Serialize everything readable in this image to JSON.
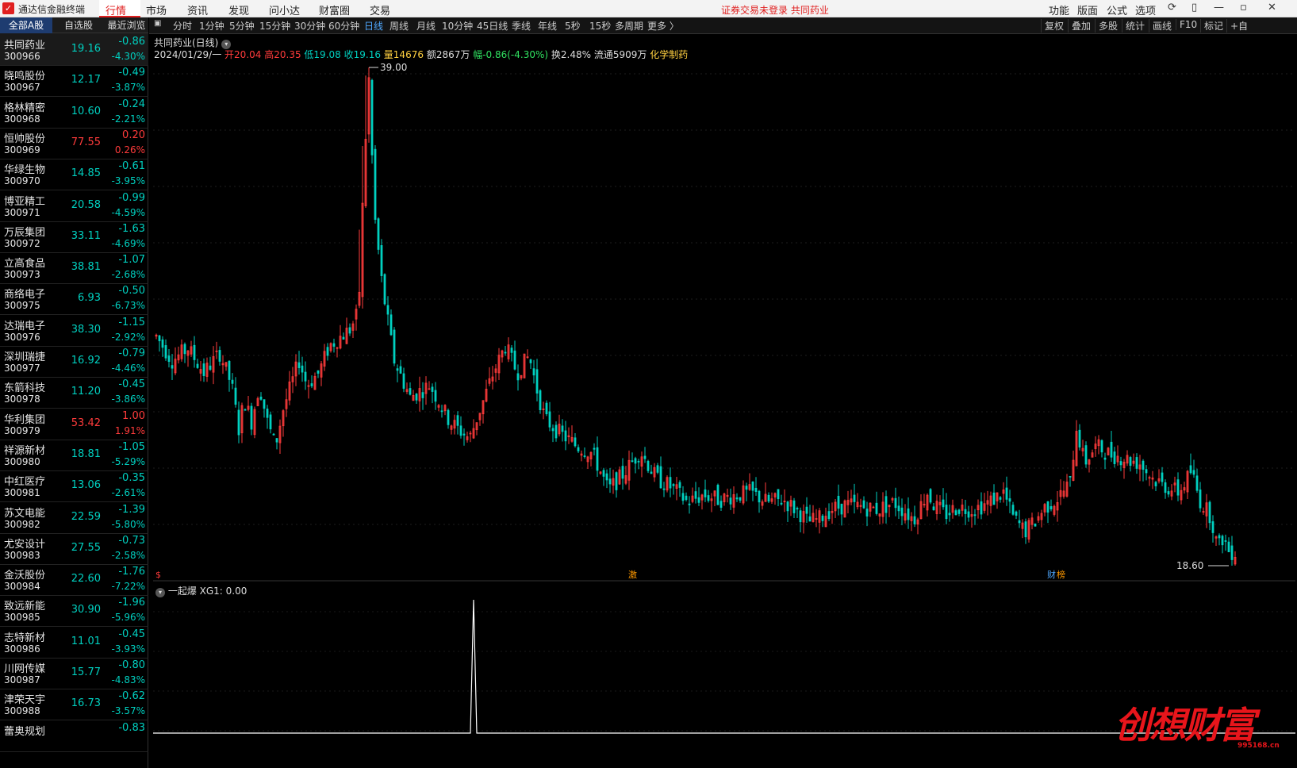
{
  "app": {
    "title": "通达信金融终端",
    "warning": "证券交易未登录 共同药业"
  },
  "main_menu": [
    "行情",
    "市场",
    "资讯",
    "发现",
    "问小达",
    "财富圈",
    "交易"
  ],
  "right_menu": [
    "功能",
    "版面",
    "公式",
    "选项"
  ],
  "left_tabs": [
    "全部A股",
    "自选股",
    "最近浏览"
  ],
  "stocks": [
    {
      "name": "共同药业",
      "code": "300966",
      "price": "19.16",
      "chg": "-0.86",
      "pct": "-4.30%",
      "dir": "dn"
    },
    {
      "name": "晓鸣股份",
      "code": "300967",
      "price": "12.17",
      "chg": "-0.49",
      "pct": "-3.87%",
      "dir": "dn"
    },
    {
      "name": "格林精密",
      "code": "300968",
      "price": "10.60",
      "chg": "-0.24",
      "pct": "-2.21%",
      "dir": "dn"
    },
    {
      "name": "恒帅股份",
      "code": "300969",
      "price": "77.55",
      "chg": "0.20",
      "pct": "0.26%",
      "dir": "up"
    },
    {
      "name": "华绿生物",
      "code": "300970",
      "price": "14.85",
      "chg": "-0.61",
      "pct": "-3.95%",
      "dir": "dn"
    },
    {
      "name": "博亚精工",
      "code": "300971",
      "price": "20.58",
      "chg": "-0.99",
      "pct": "-4.59%",
      "dir": "dn"
    },
    {
      "name": "万辰集团",
      "code": "300972",
      "price": "33.11",
      "chg": "-1.63",
      "pct": "-4.69%",
      "dir": "dn"
    },
    {
      "name": "立高食品",
      "code": "300973",
      "price": "38.81",
      "chg": "-1.07",
      "pct": "-2.68%",
      "dir": "dn"
    },
    {
      "name": "商络电子",
      "code": "300975",
      "price": "6.93",
      "chg": "-0.50",
      "pct": "-6.73%",
      "dir": "dn"
    },
    {
      "name": "达瑞电子",
      "code": "300976",
      "price": "38.30",
      "chg": "-1.15",
      "pct": "-2.92%",
      "dir": "dn"
    },
    {
      "name": "深圳瑞捷",
      "code": "300977",
      "price": "16.92",
      "chg": "-0.79",
      "pct": "-4.46%",
      "dir": "dn"
    },
    {
      "name": "东箭科技",
      "code": "300978",
      "price": "11.20",
      "chg": "-0.45",
      "pct": "-3.86%",
      "dir": "dn"
    },
    {
      "name": "华利集团",
      "code": "300979",
      "price": "53.42",
      "chg": "1.00",
      "pct": "1.91%",
      "dir": "up"
    },
    {
      "name": "祥源新材",
      "code": "300980",
      "price": "18.81",
      "chg": "-1.05",
      "pct": "-5.29%",
      "dir": "dn"
    },
    {
      "name": "中红医疗",
      "code": "300981",
      "price": "13.06",
      "chg": "-0.35",
      "pct": "-2.61%",
      "dir": "dn"
    },
    {
      "name": "苏文电能",
      "code": "300982",
      "price": "22.59",
      "chg": "-1.39",
      "pct": "-5.80%",
      "dir": "dn"
    },
    {
      "name": "尤安设计",
      "code": "300983",
      "price": "27.55",
      "chg": "-0.73",
      "pct": "-2.58%",
      "dir": "dn"
    },
    {
      "name": "金沃股份",
      "code": "300984",
      "price": "22.60",
      "chg": "-1.76",
      "pct": "-7.22%",
      "dir": "dn"
    },
    {
      "name": "致远新能",
      "code": "300985",
      "price": "30.90",
      "chg": "-1.96",
      "pct": "-5.96%",
      "dir": "dn"
    },
    {
      "name": "志特新材",
      "code": "300986",
      "price": "11.01",
      "chg": "-0.45",
      "pct": "-3.93%",
      "dir": "dn"
    },
    {
      "name": "川网传媒",
      "code": "300987",
      "price": "15.77",
      "chg": "-0.80",
      "pct": "-4.83%",
      "dir": "dn"
    },
    {
      "name": "津荣天宇",
      "code": "300988",
      "price": "16.73",
      "chg": "-0.62",
      "pct": "-3.57%",
      "dir": "dn"
    },
    {
      "name": "蕾奥规划",
      "code": "",
      "price": "",
      "chg": "-0.83",
      "pct": "",
      "dir": "dn"
    }
  ],
  "periods": [
    "分时",
    "1分钟",
    "5分钟",
    "15分钟",
    "30分钟",
    "60分钟",
    "日线",
    "周线",
    "月线",
    "10分钟",
    "45日线",
    "季线",
    "年线",
    "5秒",
    "15秒",
    "多周期",
    "更多 〉"
  ],
  "tools": [
    "复权",
    "叠加",
    "多股",
    "统计",
    "画线",
    "F10",
    "标记",
    "+自"
  ],
  "chart_title": "共同药业(日线)",
  "info": {
    "date": "2024/01/29/一",
    "open": "开20.04",
    "high": "高20.35",
    "low": "低19.08",
    "close": "收19.16",
    "vol": "量14676",
    "amount": "额2867万",
    "range": "幅-0.86(-4.30%)",
    "turnover": "换2.48%",
    "float": "流通5909万",
    "industry": "化学制药"
  },
  "high_label": "39.00",
  "low_label": "18.60",
  "event_marks": [
    "激",
    "财",
    "榜"
  ],
  "sub_indicator": "一起爆  XG1: 0.00",
  "watermark": {
    "brand": "创想财富",
    "url": "995168.cn"
  },
  "colors": {
    "up": "#ff3b3b",
    "down": "#00d0c0",
    "accent": "#e02020"
  },
  "chart_data": {
    "type": "candlestick",
    "high": 39.0,
    "low": 18.6,
    "last": {
      "date": "2024/01/29",
      "open": 20.04,
      "high": 20.35,
      "low": 19.08,
      "close": 19.16
    }
  }
}
